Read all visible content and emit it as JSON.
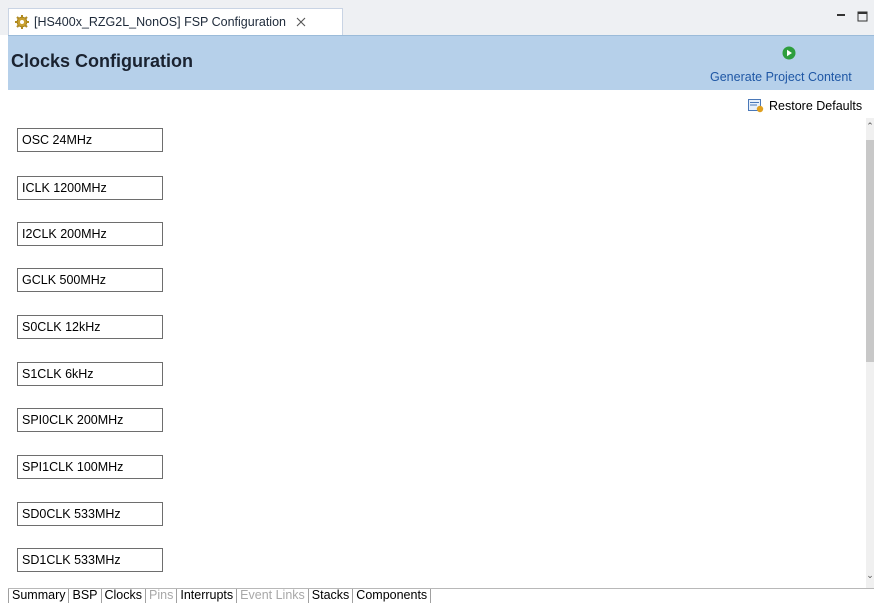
{
  "tab": {
    "title": "[HS400x_RZG2L_NonOS] FSP Configuration"
  },
  "header": {
    "title": "Clocks Configuration",
    "generate_label": "Generate Project Content"
  },
  "toolbar": {
    "restore_label": "Restore Defaults"
  },
  "clocks": [
    "OSC 24MHz",
    "ICLK 1200MHz",
    "I2CLK 200MHz",
    "GCLK 500MHz",
    "S0CLK 12kHz",
    "S1CLK 6kHz",
    "SPI0CLK 200MHz",
    "SPI1CLK 100MHz",
    "SD0CLK 533MHz",
    "SD1CLK 533MHz"
  ],
  "bottom_tabs": [
    {
      "label": "Summary",
      "state": "normal"
    },
    {
      "label": "BSP",
      "state": "normal"
    },
    {
      "label": "Clocks",
      "state": "active"
    },
    {
      "label": "Pins",
      "state": "disabled"
    },
    {
      "label": "Interrupts",
      "state": "normal"
    },
    {
      "label": "Event Links",
      "state": "disabled"
    },
    {
      "label": "Stacks",
      "state": "normal"
    },
    {
      "label": "Components",
      "state": "normal"
    }
  ],
  "icons": {
    "tab_icon": "gear-icon",
    "close": "close-icon",
    "generate": "play-icon",
    "restore": "restore-defaults-icon"
  },
  "colors": {
    "header_bg": "#b6d0ea",
    "link_blue": "#1f57a5",
    "play_green": "#2e9e3e",
    "disabled_text": "#a8a8a8"
  }
}
